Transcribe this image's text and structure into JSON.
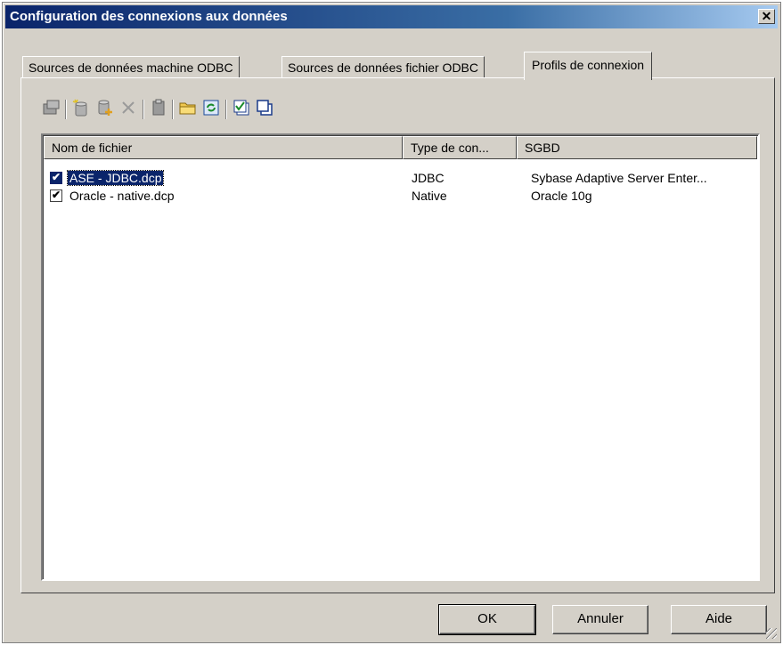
{
  "window": {
    "title": "Configuration des connexions aux données",
    "close_glyph": "✕"
  },
  "tabs": [
    {
      "label": "Sources de données machine ODBC",
      "active": false
    },
    {
      "label": "Sources de données fichier ODBC",
      "active": false
    },
    {
      "label": "Profils de connexion",
      "active": true
    }
  ],
  "toolbar": {
    "icons": [
      "properties-icon",
      "new-profile-icon",
      "add-profile-icon",
      "delete-icon",
      "clipboard-icon",
      "open-folder-icon",
      "refresh-icon",
      "test-connection-icon",
      "copy-icon"
    ]
  },
  "list": {
    "columns": [
      "Nom de fichier",
      "Type de con...",
      "SGBD"
    ],
    "rows": [
      {
        "checked": true,
        "selected": true,
        "name": "ASE - JDBC.dcp",
        "type": "JDBC",
        "dbms": "Sybase Adaptive Server Enter..."
      },
      {
        "checked": true,
        "selected": false,
        "name": "Oracle - native.dcp",
        "type": "Native",
        "dbms": "Oracle 10g"
      }
    ],
    "check_glyph": "✔"
  },
  "buttons": {
    "ok": "OK",
    "cancel": "Annuler",
    "help": "Aide"
  },
  "colors": {
    "title_bar": "#0a246a",
    "selection": "#0a246a",
    "face": "#d4d0c8"
  }
}
